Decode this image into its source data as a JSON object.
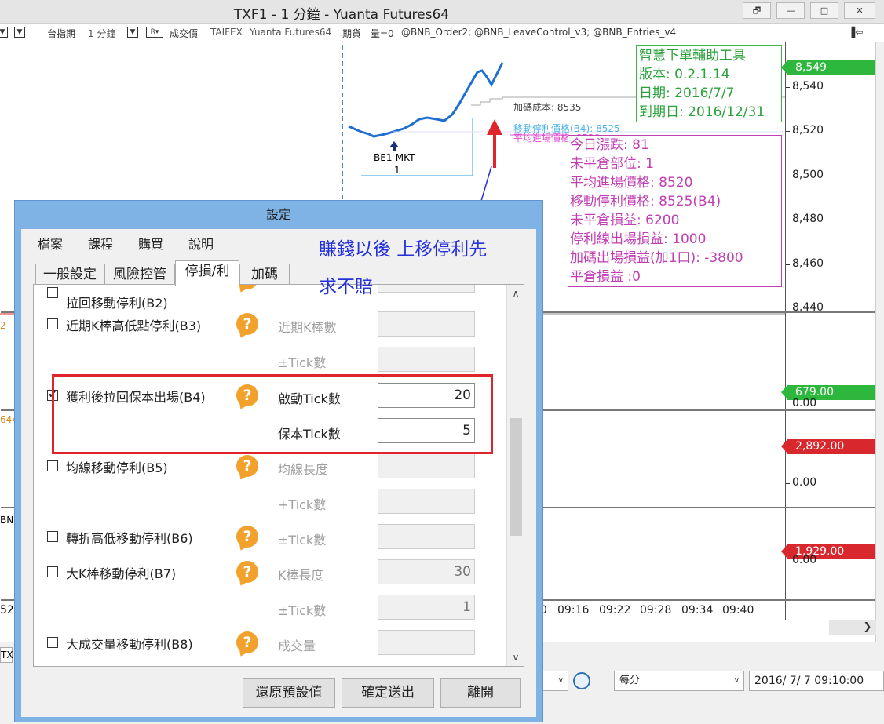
{
  "window": {
    "title": "TXF1 - 1 分鐘 - Yuanta Futures64"
  },
  "toolbar": {
    "index_label": "台指期",
    "interval": "1 分鐘",
    "price_type": "成交價",
    "exchange": "TAIFEX",
    "datasource": "Yuanta Futures64",
    "contract": "期貨",
    "volume_label": "量=0",
    "strategies": "@BNB_Order2; @BNB_LeaveControl_v3; @BNB_Entries_v4"
  },
  "chart": {
    "price_ticks": [
      "8,540",
      "8,520",
      "8,500",
      "8,480",
      "8,460",
      "8,440"
    ],
    "last_price": "8,549",
    "indicator1_value": "679.00",
    "indicator1_zero": "0.00",
    "indicator2_value": "2,892.00",
    "indicator2_zero": "0.00",
    "indicator3_value": "1,929.00",
    "indicator3_zero": "0.00",
    "time_ticks": [
      "0",
      "09:16",
      "09:22",
      "09:28",
      "09:34",
      "09:40"
    ],
    "left_labels": [
      "2",
      "644",
      "BNE",
      "52"
    ],
    "entry_marker": "BE1-MKT",
    "entry_qty": "1",
    "add_cost_label": "加碼成本: 8535",
    "trailing_stop_label": "移動停利價格(B4): 8525",
    "avg_entry_label": "平均進場價格: 8520",
    "colors": {
      "up": "#d9272e",
      "down": "#2db83d",
      "line": "#1f6fd1",
      "info_green": "#2aa13a",
      "info_magenta": "#c13fb3"
    }
  },
  "info_tool": {
    "title": "智慧下單輔助工具",
    "version": "版本: 0.2.1.14",
    "date": "日期: 2016/7/7",
    "expiry": "到期日: 2016/12/31"
  },
  "info_position": {
    "change": "今日漲跌: 81",
    "open_pos": "未平倉部位: 1",
    "avg_entry": "平均進場價格: 8520",
    "trailing_stop": "移動停利價格: 8525(B4)",
    "unrealized": "未平倉損益: 6200",
    "tp_line": "停利線出場損益: 1000",
    "add_exit": "加碼出場損益(加1口): -3800",
    "closed_pnl": "平倉損益 :0"
  },
  "bottom": {
    "period_combo": "每分",
    "datetime_combo": "2016/  7/  7 09:10:00",
    "left_tab": "TX"
  },
  "dialog": {
    "title": "設定",
    "menu": [
      "檔案",
      "課程",
      "購買",
      "說明"
    ],
    "tabs": [
      "一般設定",
      "風險控管",
      "停損/利",
      "加碼"
    ],
    "active_tab": "停損/利",
    "rows": [
      {
        "checked": false,
        "label": "拉回移動停利(B2)",
        "field_label": "",
        "value": ""
      },
      {
        "checked": false,
        "label": "近期K棒高低點停利(B3)",
        "field_label": "近期K棒數",
        "value": ""
      },
      {
        "checked": false,
        "label": "",
        "field_label": "±Tick數",
        "value": ""
      },
      {
        "checked": true,
        "label": "獲利後拉回保本出場(B4)",
        "field_label": "啟動Tick數",
        "value": "20"
      },
      {
        "checked": true,
        "label": "",
        "field_label": "保本Tick數",
        "value": "5"
      },
      {
        "checked": false,
        "label": "均線移動停利(B5)",
        "field_label": "均線長度",
        "value": ""
      },
      {
        "checked": false,
        "label": "",
        "field_label": "+Tick數",
        "value": ""
      },
      {
        "checked": false,
        "label": "轉折高低移動停利(B6)",
        "field_label": "±Tick數",
        "value": ""
      },
      {
        "checked": false,
        "label": "大K棒移動停利(B7)",
        "field_label": "K棒長度",
        "value": "30"
      },
      {
        "checked": false,
        "label": "",
        "field_label": "±Tick數",
        "value": "1"
      },
      {
        "checked": false,
        "label": "大成交量移動停利(B8)",
        "field_label": "成交量",
        "value": ""
      }
    ],
    "buttons": {
      "reset": "還原預設值",
      "submit": "確定送出",
      "exit": "離開"
    }
  },
  "annotation": {
    "note_line1": "賺錢以後 上移停利先",
    "note_line2": "求不賠"
  }
}
